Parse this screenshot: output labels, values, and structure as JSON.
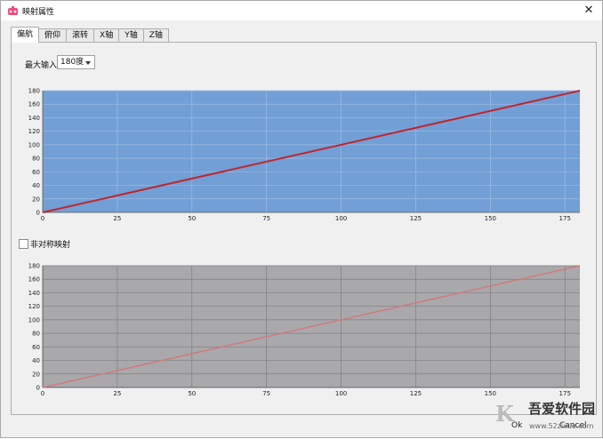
{
  "window": {
    "title": "映射属性"
  },
  "tabs": [
    "偏航",
    "俯仰",
    "滚转",
    "X轴",
    "Y轴",
    "Z轴"
  ],
  "max_input": {
    "label": "最大输入",
    "value": "180度"
  },
  "asymmetric": {
    "label": "非对称映射",
    "checked": false
  },
  "buttons": {
    "ok": "Ok",
    "cancel": "Cancel"
  },
  "watermark": {
    "text": "吾爱软件园",
    "url": "www.52zixue.com",
    "logo": "KK下载"
  },
  "colors": {
    "top_plot_bg": "#729fd5",
    "top_line": "#c0252f",
    "bottom_plot_bg": "#a9a9ac",
    "bottom_line": "#d07a7d"
  },
  "chart_data": [
    {
      "type": "line",
      "x": [
        0,
        180
      ],
      "series": [
        {
          "values": [
            0,
            180
          ]
        }
      ],
      "xticks": [
        0,
        25,
        50,
        75,
        100,
        125,
        150,
        175
      ],
      "yticks": [
        0,
        20,
        40,
        60,
        80,
        100,
        120,
        140,
        160,
        180
      ],
      "xlim": [
        0,
        180
      ],
      "ylim": [
        0,
        180
      ],
      "grid": true
    },
    {
      "type": "line",
      "x": [
        0,
        180
      ],
      "series": [
        {
          "values": [
            0,
            180
          ]
        }
      ],
      "xticks": [
        0,
        25,
        50,
        75,
        100,
        125,
        150,
        175
      ],
      "yticks": [
        0,
        20,
        40,
        60,
        80,
        100,
        120,
        140,
        160,
        180
      ],
      "xlim": [
        0,
        180
      ],
      "ylim": [
        0,
        180
      ],
      "grid": true
    }
  ]
}
